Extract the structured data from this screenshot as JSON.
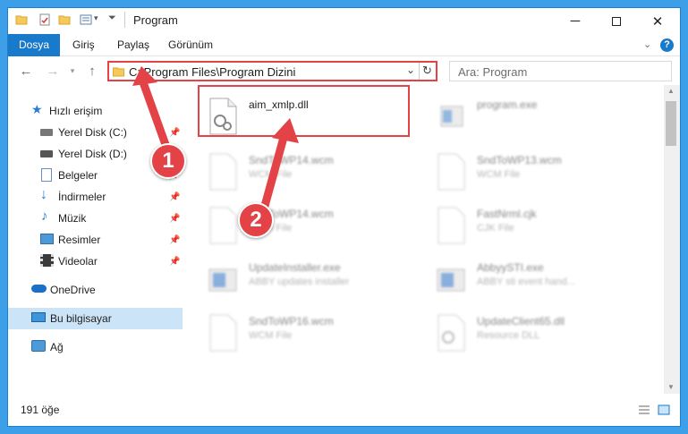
{
  "window": {
    "title": "Program"
  },
  "ribbon": {
    "tabs": [
      "Dosya",
      "Giriş",
      "Paylaş",
      "Görünüm"
    ]
  },
  "address": {
    "path": "C:\\Program Files\\Program Dizini"
  },
  "search": {
    "placeholder": "Ara: Program"
  },
  "sidebar": {
    "items": [
      {
        "label": "Hızlı erişim",
        "icon": "star-icon"
      },
      {
        "label": "Yerel Disk (C:)",
        "icon": "drive-icon"
      },
      {
        "label": "Yerel Disk (D:)",
        "icon": "drive-icon"
      },
      {
        "label": "Belgeler",
        "icon": "documents-icon"
      },
      {
        "label": "İndirmeler",
        "icon": "download-icon"
      },
      {
        "label": "Müzik",
        "icon": "music-icon"
      },
      {
        "label": "Resimler",
        "icon": "pictures-icon"
      },
      {
        "label": "Videolar",
        "icon": "videos-icon"
      },
      {
        "label": "OneDrive",
        "icon": "cloud-icon"
      },
      {
        "label": "Bu bilgisayar",
        "icon": "computer-icon"
      },
      {
        "label": "Ağ",
        "icon": "network-icon"
      }
    ]
  },
  "files": [
    {
      "name": "aim_xmlp.dll",
      "sub": ""
    },
    {
      "name": "program.exe",
      "sub": ""
    },
    {
      "name": "SndToWP14.wcm",
      "sub": "WCM File"
    },
    {
      "name": "SndToWP13.wcm",
      "sub": "WCM File"
    },
    {
      "name": "SndToWP14.wcm",
      "sub": "WCM File"
    },
    {
      "name": "FastNrml.cjk",
      "sub": "CJK File"
    },
    {
      "name": "UpdateInstaller.exe",
      "sub": "ABBY updates installer"
    },
    {
      "name": "AbbyySTI.exe",
      "sub": "ABBY sti event hand..."
    },
    {
      "name": "SndToWP16.wcm",
      "sub": "WCM File"
    },
    {
      "name": "UpdateClient65.dll",
      "sub": "Resource DLL"
    }
  ],
  "status": {
    "count": "191 öğe"
  },
  "annotations": {
    "step1": "1",
    "step2": "2"
  },
  "colors": {
    "accent": "#1979ca",
    "highlight": "#e34346"
  }
}
